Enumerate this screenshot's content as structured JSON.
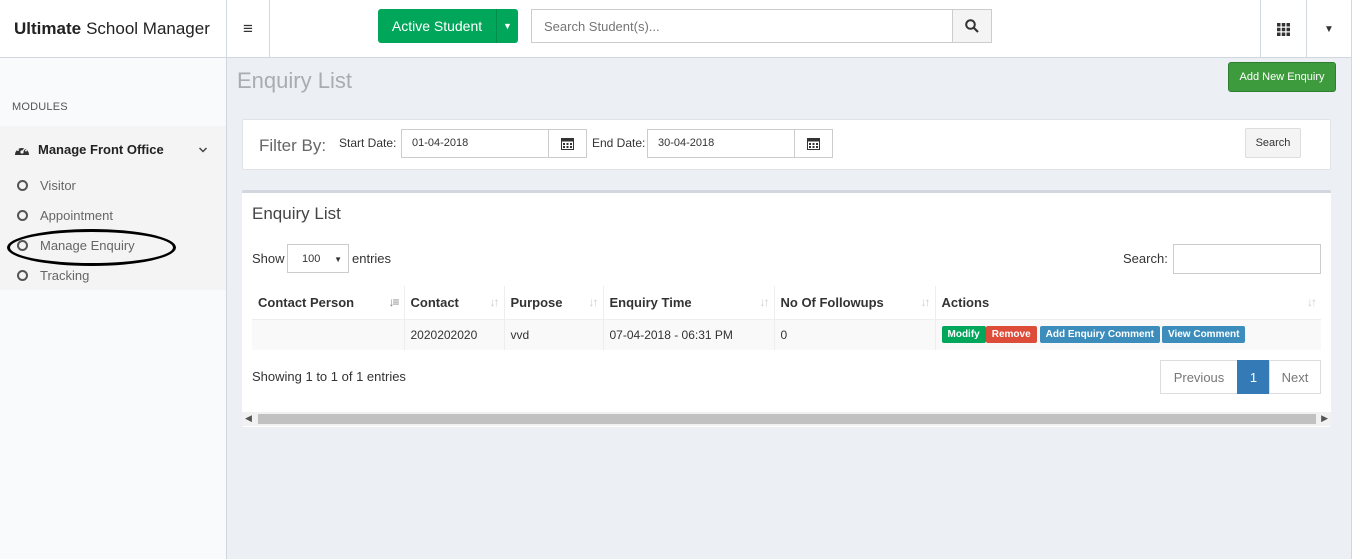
{
  "header": {
    "brand_bold": "Ultimate",
    "brand_rest": "School Manager",
    "active_student_label": "Active Student",
    "search_placeholder": "Search Student(s)..."
  },
  "sidebar": {
    "modules_label": "MODULES",
    "menu_title": "Manage Front Office",
    "items": [
      {
        "label": "Visitor"
      },
      {
        "label": "Appointment"
      },
      {
        "label": "Manage Enquiry"
      },
      {
        "label": "Tracking"
      }
    ]
  },
  "page": {
    "title": "Enquiry List",
    "add_button": "Add New Enquiry"
  },
  "filter": {
    "label": "Filter By:",
    "start_label": "Start Date:",
    "start_value": "01-04-2018",
    "end_label": "End Date:",
    "end_value": "30-04-2018",
    "search_button": "Search"
  },
  "list": {
    "title": "Enquiry List",
    "show_label": "Show",
    "show_value": "100",
    "entries_label": "entries",
    "search_label": "Search:",
    "columns": [
      "Contact Person",
      "Contact",
      "Purpose",
      "Enquiry Time",
      "No Of Followups",
      "Actions"
    ],
    "rows": [
      {
        "contact_person": "",
        "contact": "2020202020",
        "purpose": "vvd",
        "enquiry_time": "07-04-2018 - 06:31 PM",
        "followups": "0"
      }
    ],
    "actions": {
      "modify": "Modify",
      "remove": "Remove",
      "add_comment": "Add Enquiry Comment",
      "view_comment": "View Comment"
    },
    "showing_text": "Showing 1 to 1 of 1 entries",
    "pagination": {
      "previous": "Previous",
      "current": "1",
      "next": "Next"
    }
  },
  "colors": {
    "primary_green": "#00a65a",
    "danger": "#dd4b39",
    "info": "#3c8dbc",
    "page_bg": "#ecf0f5"
  }
}
